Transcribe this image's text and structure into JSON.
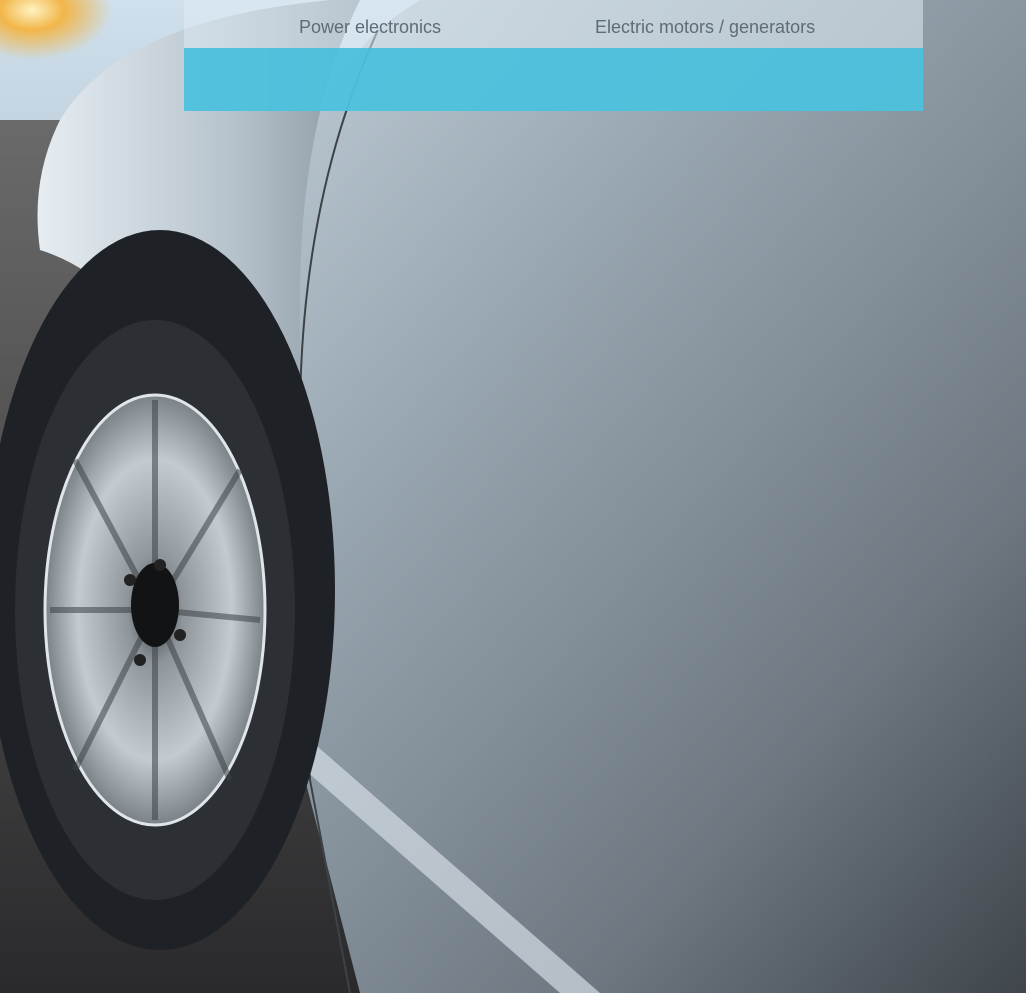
{
  "nav": {
    "items": [
      {
        "label": "Power electronics"
      },
      {
        "label": "Electric motors / generators"
      }
    ]
  },
  "colors": {
    "accent_band": "#4cc1dd",
    "nav_text": "#5f6b76"
  },
  "hero_image": {
    "icon": "car-photo"
  }
}
